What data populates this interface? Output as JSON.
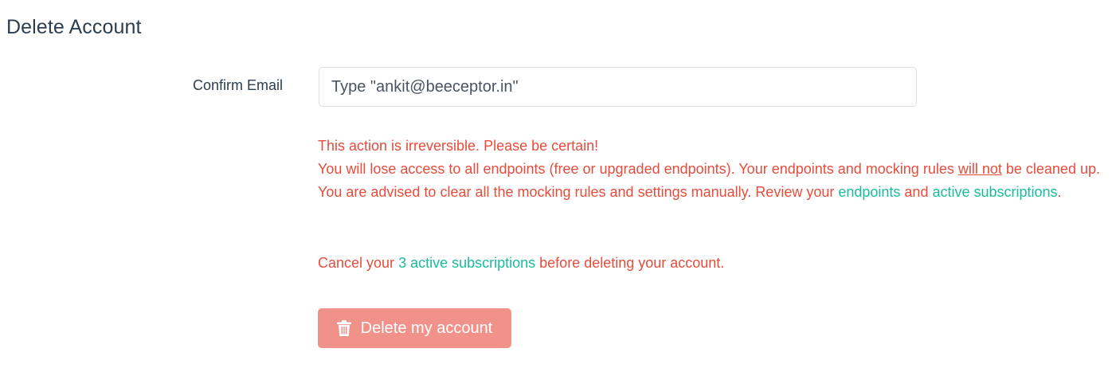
{
  "page": {
    "title": "Delete Account"
  },
  "form": {
    "confirm_label": "Confirm Email",
    "email_placeholder": "Type \"ankit@beeceptor.in\"",
    "email_value": ""
  },
  "warning": {
    "line1": "This action is irreversible. Please be certain!",
    "line2_pre": "You will lose access to all endpoints (free or upgraded endpoints). Your endpoints and mocking rules ",
    "line2_emph": "will not",
    "line2_post": " be cleaned up. You are advised to clear all the mocking rules and settings manually. Review your ",
    "endpoints_link": "endpoints",
    "and_text": " and ",
    "subscriptions_link": "active subscriptions",
    "period": "."
  },
  "cancel_note": {
    "pre": "Cancel your ",
    "link": "3 active subscriptions",
    "post": " before deleting your account."
  },
  "delete_button": {
    "label": "Delete my account",
    "icon": "trash-icon",
    "disabled": true
  },
  "colors": {
    "danger": "#e74c3c",
    "link": "#1abc9c",
    "button_bg": "#f1928a",
    "text": "#2c3e50"
  }
}
